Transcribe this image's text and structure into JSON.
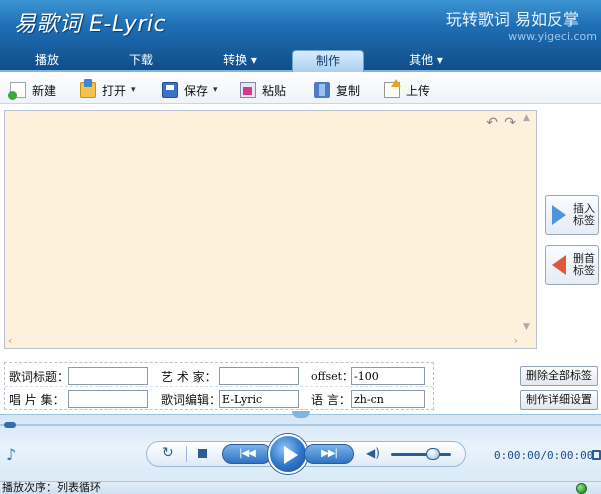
{
  "header": {
    "app_title": "易歌词 E-Lyric",
    "slogan": "玩转歌词 易如反掌",
    "url": "www.yigeci.com"
  },
  "nav": {
    "tabs": [
      {
        "label": "播放"
      },
      {
        "label": "下载"
      },
      {
        "label": "转换 ▾"
      },
      {
        "label": "制作",
        "active": true
      },
      {
        "label": "其他 ▾"
      }
    ]
  },
  "toolbar": {
    "new_label": "新建",
    "open_label": "打开",
    "save_label": "保存",
    "paste_label": "粘贴",
    "copy_label": "复制",
    "upload_label": "上传"
  },
  "editor": {
    "content": "",
    "undo_icon": "undo-icon",
    "redo_icon": "redo-icon"
  },
  "side": {
    "insert_tag": "插入标签",
    "delete_first_tag": "删首标签"
  },
  "meta": {
    "title_label": "歌词标题：",
    "title_value": "",
    "album_label": "唱 片 集：",
    "album_value": "",
    "artist_label": "艺 术 家：",
    "artist_value": "",
    "editor_label": "歌词编辑：",
    "editor_value": "E-Lyric",
    "offset_label": "offset：",
    "offset_value": "-100",
    "lang_label": "语  言：",
    "lang_value": "zh-cn"
  },
  "actions": {
    "delete_all_tags": "删除全部标签",
    "detail_settings": "制作详细设置"
  },
  "player": {
    "time": "0:00:00/0:00:00",
    "seek_progress": 0,
    "volume_level": 0.6
  },
  "status": {
    "play_order": "播放次序：列表循环"
  },
  "colors": {
    "accent": "#1f6fb5",
    "editor_bg": "#fdf1dc"
  }
}
